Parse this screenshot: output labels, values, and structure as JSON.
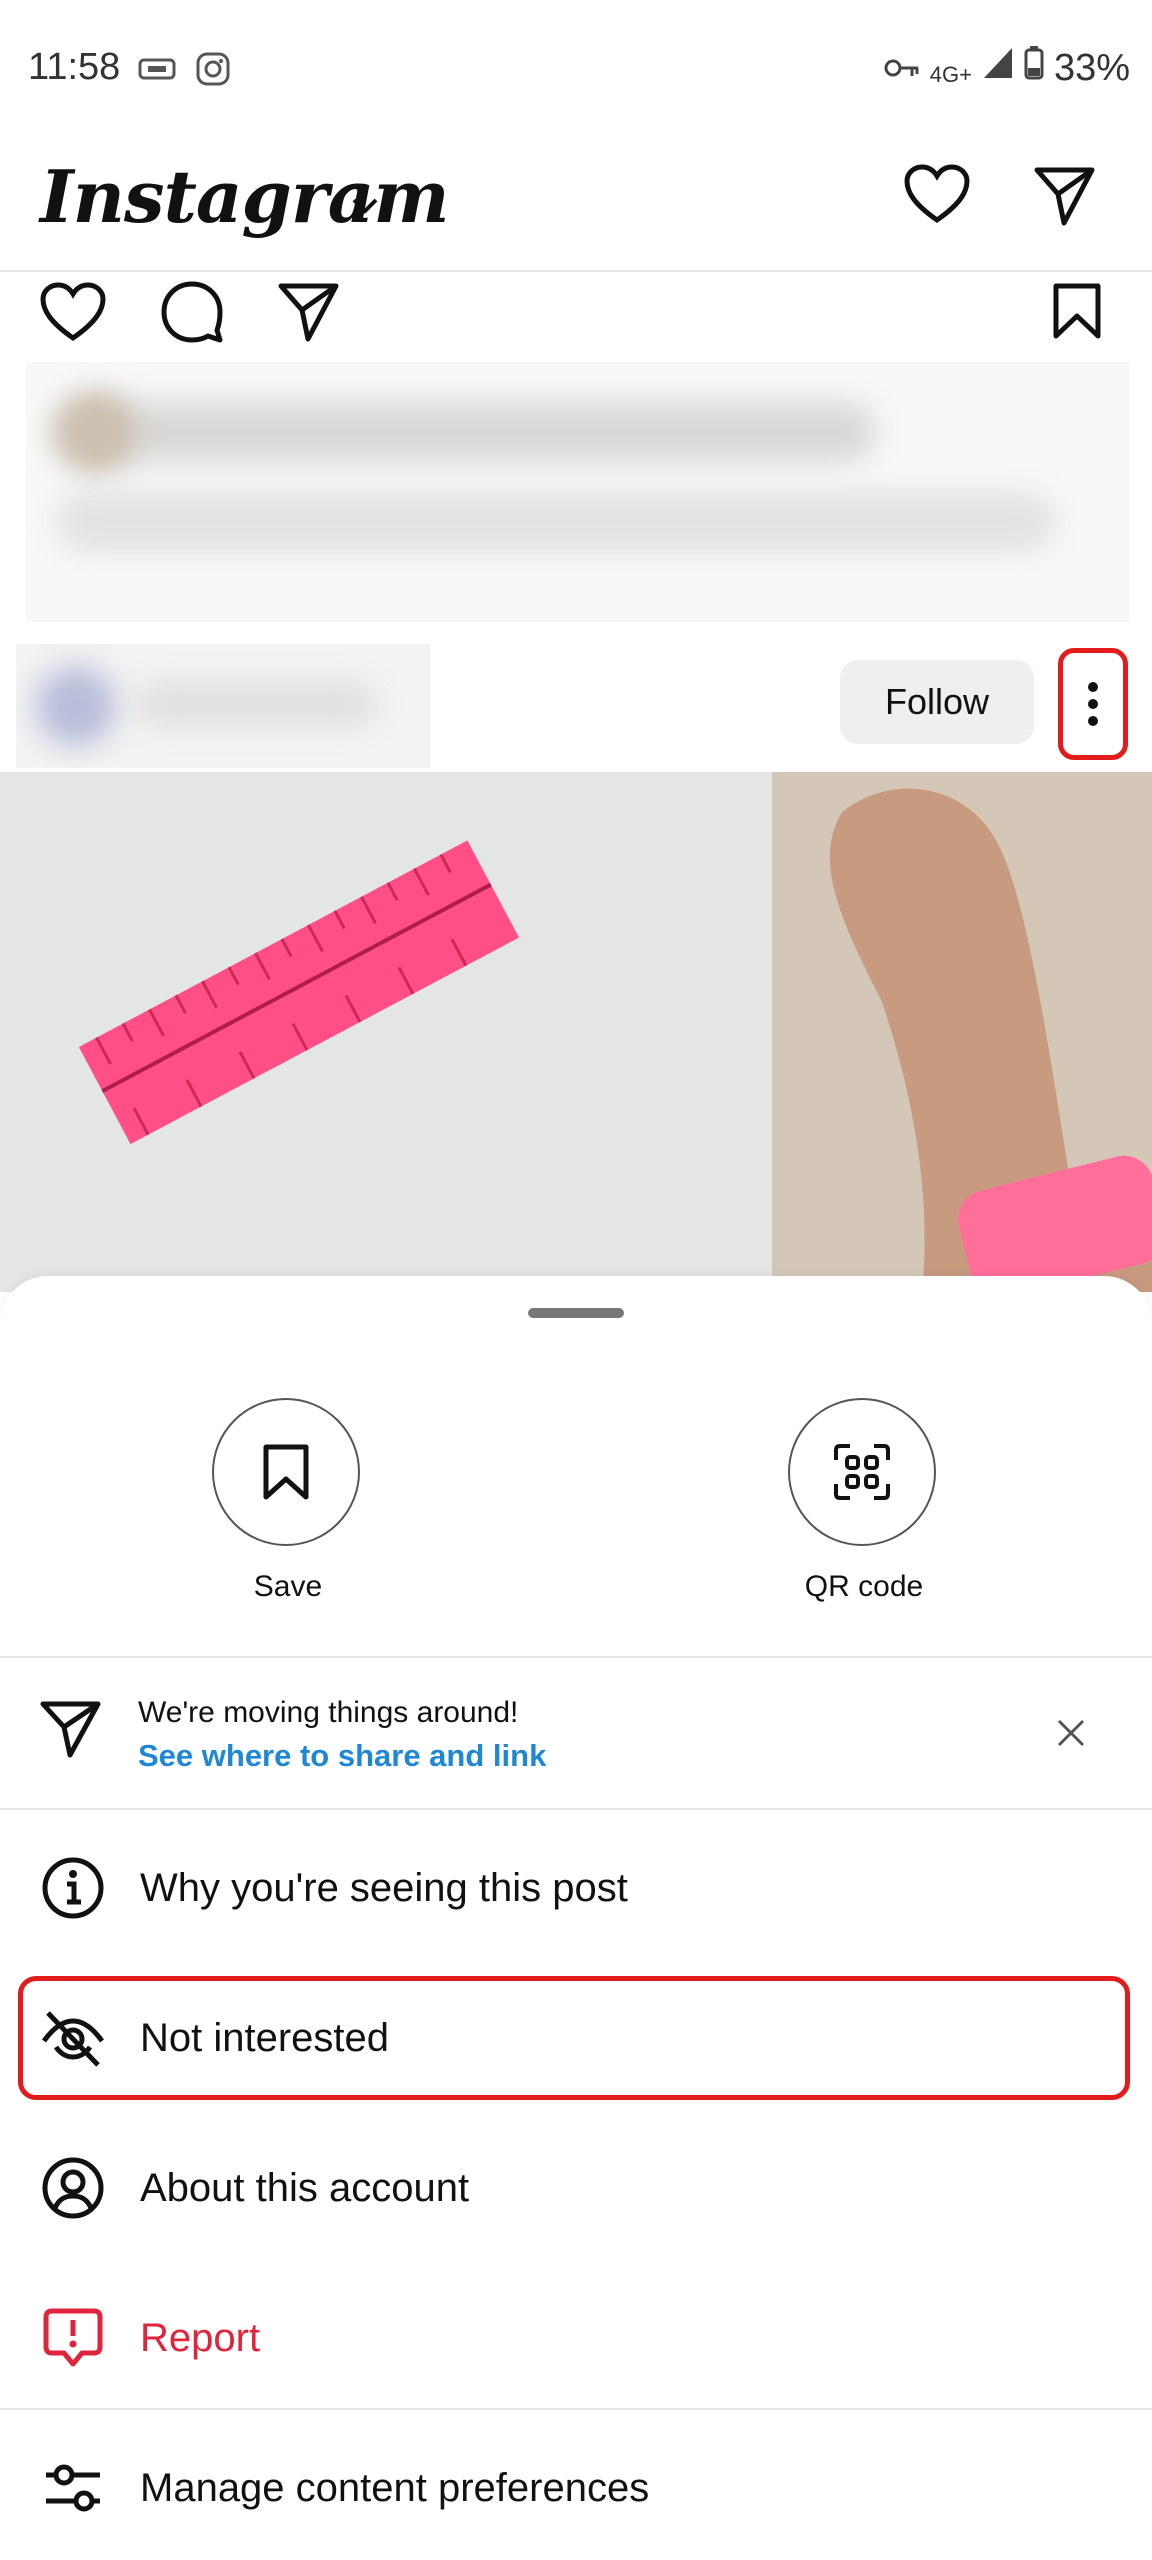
{
  "status_bar": {
    "time": "11:58",
    "network": "4G+",
    "battery": "33%",
    "icons": [
      "vpn-key-icon",
      "instagram-app-icon",
      "signal-icon",
      "battery-icon"
    ]
  },
  "header": {
    "logo": "Instagram",
    "icons": [
      "chevron-down-icon",
      "heart-icon",
      "send-icon"
    ]
  },
  "post_actions": {
    "icons": [
      "like-icon",
      "comment-icon",
      "share-icon",
      "bookmark-icon"
    ]
  },
  "next_post": {
    "follow_label": "Follow",
    "more_icon": "more-vertical-icon"
  },
  "sheet": {
    "quick_actions": [
      {
        "label": "Save",
        "icon": "bookmark-icon"
      },
      {
        "label": "QR code",
        "icon": "qr-code-icon"
      }
    ],
    "notice": {
      "text": "We're moving things around!",
      "link": "See where to share and link",
      "icon": "send-icon"
    },
    "menu": [
      {
        "label": "Why you're seeing this post",
        "icon": "info-icon"
      },
      {
        "label": "Not interested",
        "icon": "eye-off-icon"
      },
      {
        "label": "About this account",
        "icon": "account-circle-icon"
      },
      {
        "label": "Report",
        "icon": "report-icon"
      },
      {
        "label": "Manage content preferences",
        "icon": "sliders-icon"
      }
    ]
  },
  "colors": {
    "accent_link": "#1e88d6",
    "report_red": "#e0243b",
    "highlight_red": "#e41b1b",
    "ruler_pink": "#ff4f86"
  }
}
